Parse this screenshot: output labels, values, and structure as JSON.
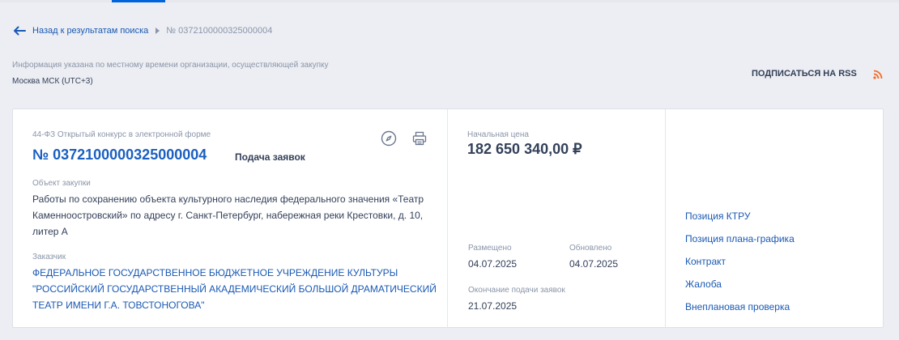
{
  "breadcrumb": {
    "back_label": "Назад к результатам поиска",
    "current": "№ 0372100000325000004"
  },
  "timezone": {
    "note": "Информация указана по местному времени организации, осуществляющей закупку",
    "value": "Москва МСК (UTC+3)"
  },
  "rss": {
    "label": "ПОДПИСАТЬСЯ НА RSS"
  },
  "card": {
    "law": "44-ФЗ Открытый конкурс в электронной форме",
    "number": "№ 0372100000325000004",
    "status": "Подача заявок",
    "object_label": "Объект закупки",
    "object_text": "Работы по сохранению объекта культурного наследия федерального значения «Театр Каменноостровский» по адресу г. Санкт-Петербург, набережная реки Крестовки, д. 10, литер А",
    "customer_label": "Заказчик",
    "customer": "ФЕДЕРАЛЬНОЕ ГОСУДАРСТВЕННОЕ БЮДЖЕТНОЕ УЧРЕЖДЕНИЕ КУЛЬТУРЫ \"РОССИЙСКИЙ ГОСУДАРСТВЕННЫЙ АКАДЕМИЧЕСКИЙ БОЛЬШОЙ ДРАМАТИЧЕСКИЙ ТЕАТР ИМЕНИ Г.А. ТОВСТОНОГОВА\"",
    "price_label": "Начальная цена",
    "price": "182 650 340,00 ₽",
    "posted_label": "Размещено",
    "posted": "04.07.2025",
    "updated_label": "Обновлено",
    "updated": "04.07.2025",
    "deadline_label": "Окончание подачи заявок",
    "deadline": "21.07.2025",
    "links": [
      "Позиция КТРУ",
      "Позиция плана-графика",
      "Контракт",
      "Жалоба",
      "Внеплановая проверка"
    ]
  },
  "colors": {
    "link": "#1a59b3",
    "number": "#1a5fc1",
    "rss": "#f26b2a",
    "page_bg": "#eceef3"
  },
  "icons": [
    "arrow-left-icon",
    "caret-right-icon",
    "rss-icon",
    "compass-icon",
    "printer-icon"
  ]
}
